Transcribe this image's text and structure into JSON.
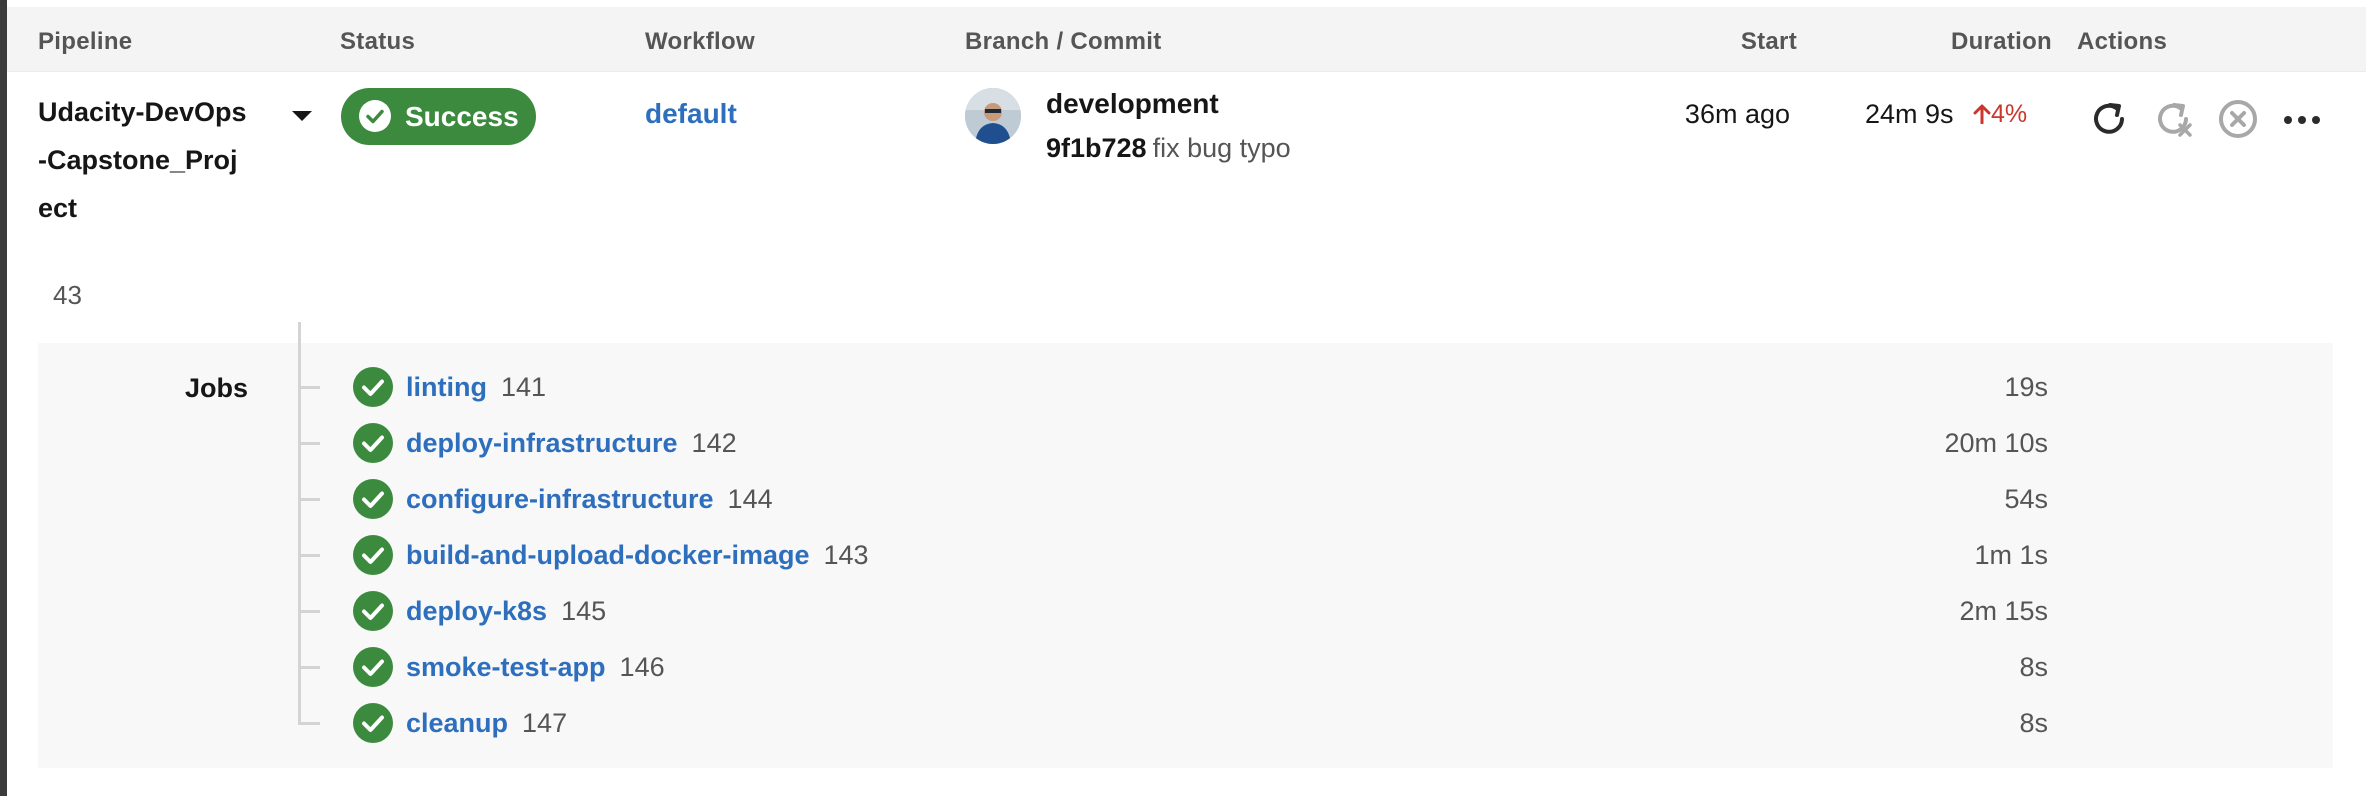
{
  "header": {
    "pipeline": "Pipeline",
    "status": "Status",
    "workflow": "Workflow",
    "branch_commit": "Branch / Commit",
    "start": "Start",
    "duration": "Duration",
    "actions": "Actions"
  },
  "pipeline": {
    "project": "Udacity-DevOps-Capstone_Project",
    "number": "43",
    "status": "Success",
    "workflow": "default",
    "branch": "development",
    "commit_sha": "9f1b728",
    "commit_message": "fix bug typo",
    "start": "36m ago",
    "duration": "24m 9s",
    "duration_change": "4%",
    "duration_change_icon": "arrow-up-icon"
  },
  "actions": [
    "rerun-icon",
    "rerun-failed-icon",
    "cancel-icon",
    "more-icon"
  ],
  "jobs_label": "Jobs",
  "jobs": [
    {
      "name": "linting",
      "number": "141",
      "duration": "19s"
    },
    {
      "name": "deploy-infrastructure",
      "number": "142",
      "duration": "20m 10s"
    },
    {
      "name": "configure-infrastructure",
      "number": "144",
      "duration": "54s"
    },
    {
      "name": "build-and-upload-docker-image",
      "number": "143",
      "duration": "1m 1s"
    },
    {
      "name": "deploy-k8s",
      "number": "145",
      "duration": "2m 15s"
    },
    {
      "name": "smoke-test-app",
      "number": "146",
      "duration": "8s"
    },
    {
      "name": "cleanup",
      "number": "147",
      "duration": "8s"
    }
  ],
  "colors": {
    "success": "#3b8a3e",
    "link": "#2e6fbd",
    "increase": "#c9372c"
  }
}
